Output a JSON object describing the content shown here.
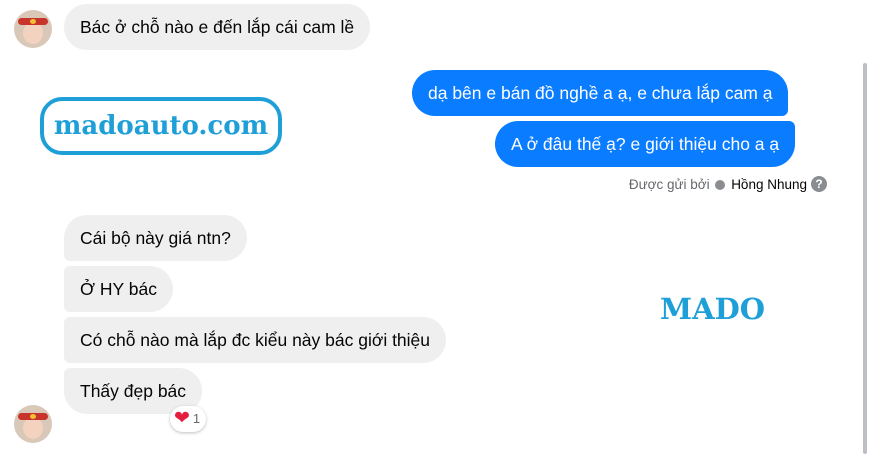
{
  "conversation": {
    "messages": [
      {
        "direction": "incoming",
        "text": "Bác ở chỗ nào e đến lắp cái cam lề"
      },
      {
        "direction": "outgoing",
        "text": "dạ bên e bán đồ nghề a ạ, e chưa lắp cam ạ"
      },
      {
        "direction": "outgoing",
        "text": "A ở đâu thế ạ? e giới thiệu cho a ạ"
      },
      {
        "direction": "incoming",
        "text": "Cái bộ này giá ntn?"
      },
      {
        "direction": "incoming",
        "text": "Ở HY bác"
      },
      {
        "direction": "incoming",
        "text": "Có chỗ nào mà lắp đc kiểu này bác giới thiệu"
      },
      {
        "direction": "incoming",
        "text": "Thấy đẹp bác"
      }
    ],
    "sent_by": {
      "prefix": "Được gửi bởi",
      "name": "Hồng Nhung"
    },
    "reaction": {
      "emoji": "heart",
      "symbol": "❤",
      "count": "1"
    }
  },
  "watermark": {
    "logo_text": "madoauto.com",
    "brand_text": "MADO"
  },
  "colors": {
    "outgoing_bubble": "#0a7cff",
    "incoming_bubble": "#efefef",
    "watermark": "#1f9fd8",
    "reaction_heart": "#e41e3f"
  }
}
